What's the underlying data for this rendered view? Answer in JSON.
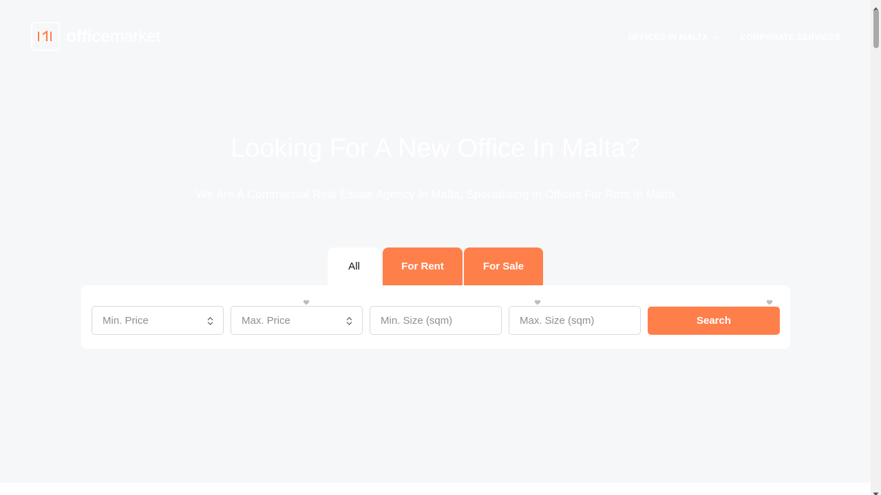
{
  "header": {
    "logo_bold": "office",
    "logo_light": "market",
    "nav": [
      {
        "label": "OFFICES IN MALTA",
        "has_dropdown": true
      },
      {
        "label": "CORPORATE SERVICES",
        "has_dropdown": false
      }
    ]
  },
  "hero": {
    "title": "Looking For A New Office In Malta?",
    "subtitle": "We Are A Commercial Real Estate Agency In Malta, Specialising In Offices For Rent In Malta"
  },
  "tabs": [
    {
      "label": "All",
      "active": true
    },
    {
      "label": "For Rent",
      "active": false
    },
    {
      "label": "For Sale",
      "active": false
    }
  ],
  "search": {
    "min_price": "Min. Price",
    "max_price": "Max. Price",
    "min_size": "Min. Size (sqm)",
    "max_size": "Max. Size (sqm)",
    "button": "Search"
  },
  "colors": {
    "accent": "#ff7f4b",
    "background": "#f6f7f9"
  },
  "icons": {
    "logo": "logo-mark-icon",
    "dropdown": "chevron-down-icon",
    "select": "up-down-arrows-icon",
    "favorite": "heart-icon"
  }
}
